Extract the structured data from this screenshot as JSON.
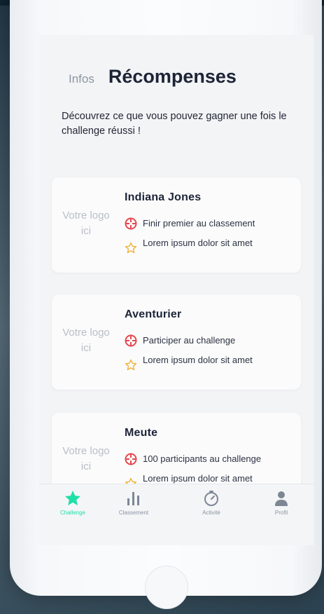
{
  "header": {
    "tab_infos": "Infos",
    "tab_rewards": "Récompenses"
  },
  "intro_text": "Découvrez ce que vous pouvez gagner une fois le challenge réussi !",
  "cards": [
    {
      "logo_placeholder": "Votre logo ici",
      "title": "Indiana Jones",
      "condition": "Finir premier au classement",
      "reward": "Lorem ipsum dolor sit amet"
    },
    {
      "logo_placeholder": "Votre logo ici",
      "title": "Aventurier",
      "condition": "Participer au challenge",
      "reward": "Lorem ipsum dolor sit amet"
    },
    {
      "logo_placeholder": "Votre logo ici",
      "title": "Meute",
      "condition": "100 participants au challenge",
      "reward": "Lorem ipsum dolor sit amet"
    }
  ],
  "navbar": {
    "items": [
      {
        "label": "Challenge",
        "icon": "star-icon",
        "active": true
      },
      {
        "label": "Classement",
        "icon": "bar-chart-icon",
        "active": false
      },
      {
        "label": "Activité",
        "icon": "timer-icon",
        "active": false
      },
      {
        "label": "Profil",
        "icon": "user-icon",
        "active": false
      }
    ]
  },
  "colors": {
    "accent": "#1ee0a6",
    "condition_icon": "#e5484d",
    "reward_star": "#f2b233",
    "title_text": "#1c2436"
  }
}
